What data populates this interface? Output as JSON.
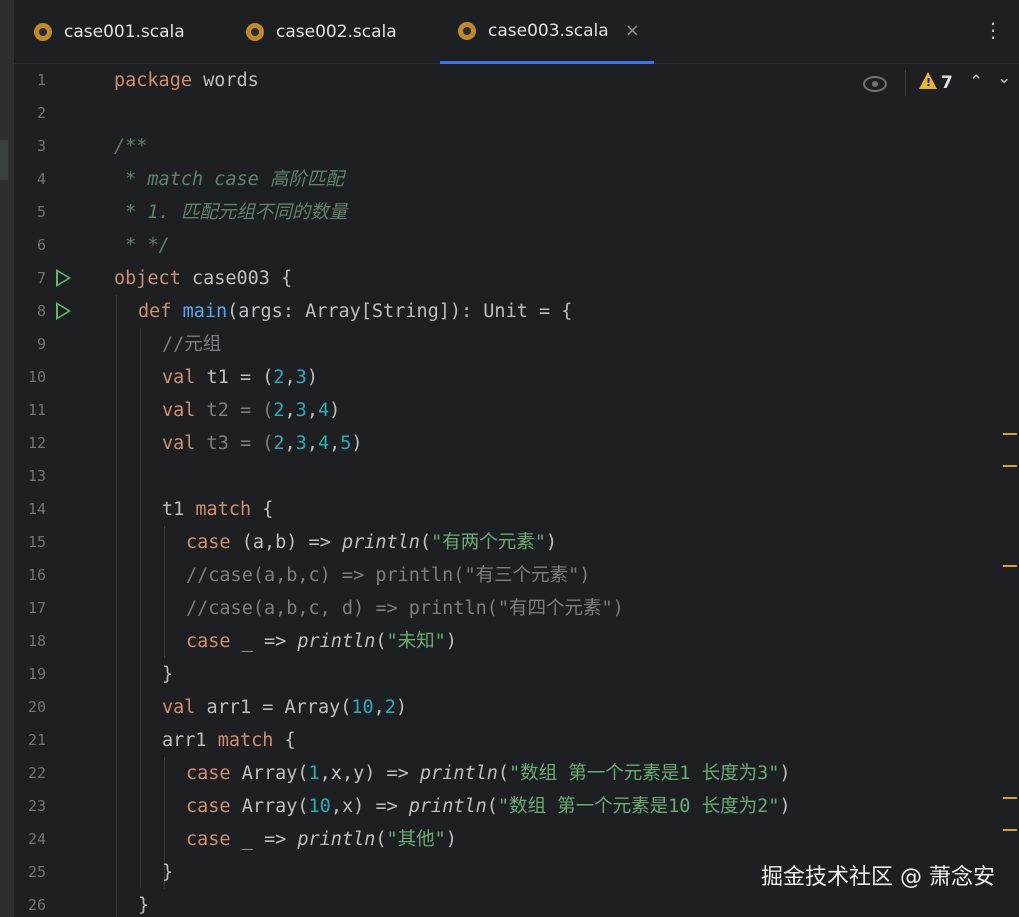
{
  "tabs": [
    {
      "label": "case001.scala",
      "active": false
    },
    {
      "label": "case002.scala",
      "active": false
    },
    {
      "label": "case003.scala",
      "active": true
    }
  ],
  "tab_close_glyph": "×",
  "menu_glyph": "⋮",
  "inspections": {
    "warning_count": "7",
    "up_glyph": "⌃",
    "down_glyph": "⌄"
  },
  "line_numbers": [
    "1",
    "2",
    "3",
    "4",
    "5",
    "6",
    "7",
    "8",
    "9",
    "10",
    "11",
    "12",
    "13",
    "14",
    "15",
    "16",
    "17",
    "18",
    "19",
    "20",
    "21",
    "22",
    "23",
    "24",
    "25",
    "26"
  ],
  "code": {
    "l1": {
      "kw": "package",
      "rest": " words"
    },
    "l3": "/**",
    "l4": " * match case 高阶匹配",
    "l5": " * 1. 匹配元组不同的数量",
    "l6": " * */",
    "l7": {
      "kw": "object",
      "rest": " case003 {"
    },
    "l8": {
      "kw": "def",
      "fn": "main",
      "rest": "(args: Array[String]): Unit = {"
    },
    "l9": "//元组",
    "l10": {
      "kw": "val",
      "name": " t1 = (",
      "n1": "2",
      "c1": ",",
      "n2": "3",
      "end": ")"
    },
    "l11": {
      "kw": "val",
      "name": " t2 = (",
      "n1": "2",
      "c1": ",",
      "n2": "3",
      "c2": ",",
      "n3": "4",
      "end": ")"
    },
    "l12": {
      "kw": "val",
      "name": " t3 = (",
      "n1": "2",
      "c1": ",",
      "n2": "3",
      "c2": ",",
      "n3": "4",
      "c3": ",",
      "n4": "5",
      "end": ")"
    },
    "l14": {
      "pre": "t1 ",
      "kw": "match",
      "post": " {"
    },
    "l15": {
      "kw": "case",
      "mid": " (a,b) => ",
      "fn": "println",
      "open": "(",
      "str": "\"有两个元素\"",
      "close": ")"
    },
    "l16": "//case(a,b,c) => println(\"有三个元素\")",
    "l17": "//case(a,b,c, d) => println(\"有四个元素\")",
    "l18": {
      "kw": "case",
      "mid": " _ => ",
      "fn": "println",
      "open": "(",
      "str": "\"未知\"",
      "close": ")"
    },
    "l19": "}",
    "l20": {
      "kw": "val",
      "name": " arr1 = Array(",
      "n1": "10",
      "c1": ",",
      "n2": "2",
      "end": ")"
    },
    "l21": {
      "pre": "arr1 ",
      "kw": "match",
      "post": " {"
    },
    "l22": {
      "kw": "case",
      "mid1": " Array(",
      "n1": "1",
      "mid2": ",x,y) => ",
      "fn": "println",
      "open": "(",
      "str": "\"数组 第一个元素是1 长度为3\"",
      "close": ")"
    },
    "l23": {
      "kw": "case",
      "mid1": " Array(",
      "n1": "10",
      "mid2": ",x) => ",
      "fn": "println",
      "open": "(",
      "str": "\"数组 第一个元素是10 长度为2\"",
      "close": ")"
    },
    "l24": {
      "kw": "case",
      "mid": " _ => ",
      "fn": "println",
      "open": "(",
      "str": "\"其他\"",
      "close": ")"
    },
    "l25": "}",
    "l26": "}"
  },
  "watermark": "掘金技术社区 @ 萧念安",
  "colors": {
    "keyword": "#cf8e6d",
    "function": "#56a8f5",
    "number": "#2aacb8",
    "string": "#6aab73",
    "comment": "#7a7e85",
    "doc": "#5f826b",
    "warning": "#e8b43a",
    "run": "#5fb865"
  }
}
